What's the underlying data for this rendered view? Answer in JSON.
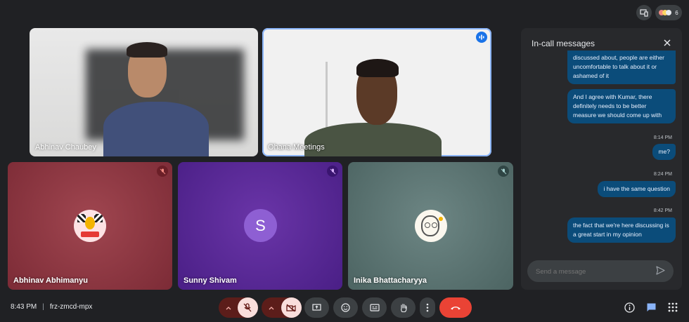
{
  "top": {
    "participant_count": "6"
  },
  "tiles": [
    {
      "name": "Abhinav Chaubey"
    },
    {
      "name": "Ohana Meetings"
    },
    {
      "name": "Abhinav Abhimanyu"
    },
    {
      "name": "Sunny Shivam",
      "initial": "S"
    },
    {
      "name": "Inika Bhattacharyya"
    }
  ],
  "chat": {
    "title": "In-call messages",
    "messages": [
      {
        "text": "discussed about, people are either uncomfortable to talk about it or ashamed of it"
      },
      {
        "text": "And I agree with Kumar, there definitely needs to be better measure we should come up with"
      },
      {
        "time": "8:14 PM",
        "text": "me?"
      },
      {
        "time": "8:24 PM",
        "text": "i have the same question"
      },
      {
        "time": "8:42 PM",
        "text": "the fact that we're here discussing is a great start in my opinion"
      }
    ],
    "input_placeholder": "Send a message"
  },
  "bottom": {
    "time": "8:43 PM",
    "separator": "|",
    "meeting_code": "frz-zmcd-mpx"
  },
  "colors": {
    "background": "#202124",
    "bubble": "#0b4c7a",
    "end_call": "#ea4335",
    "active_chat": "#8ab4f8"
  }
}
